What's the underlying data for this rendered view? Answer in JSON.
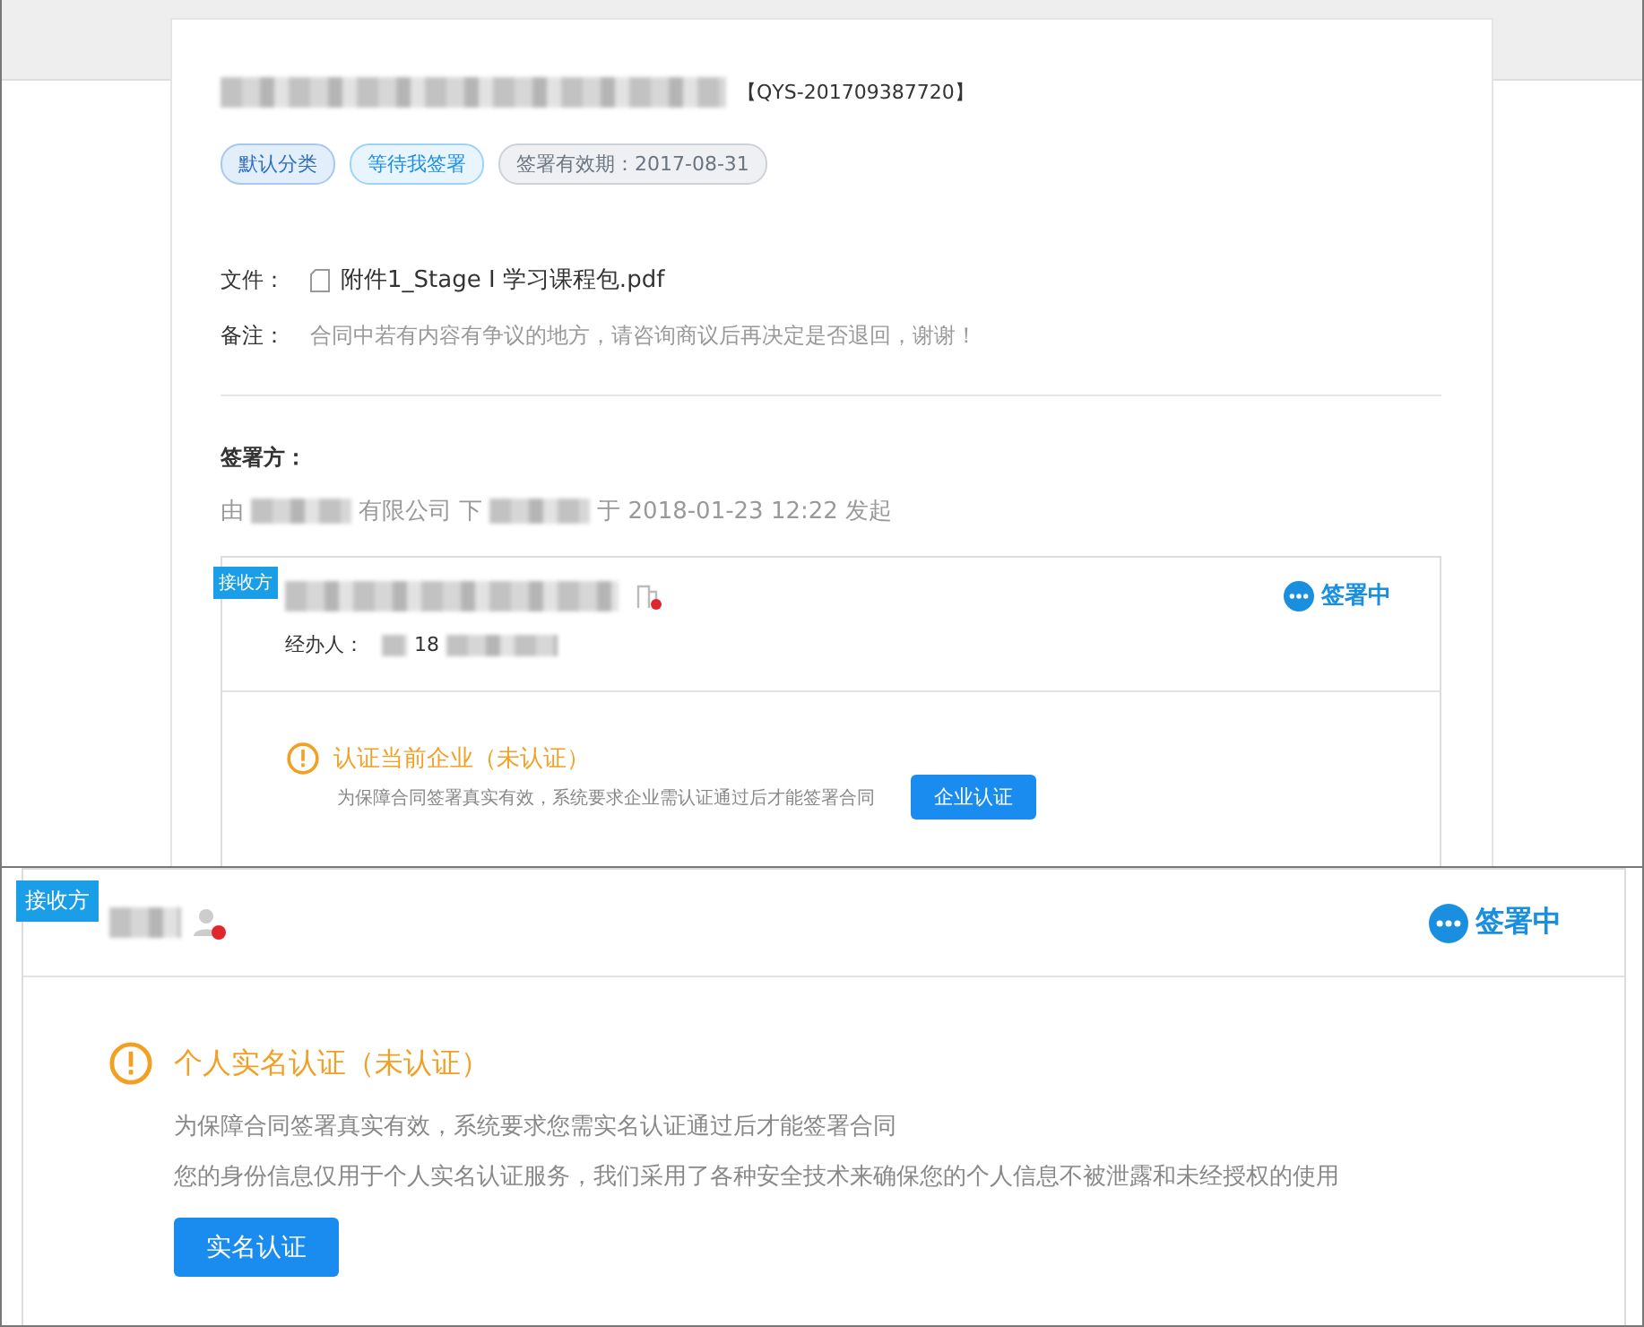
{
  "contract": {
    "code": "【QYS-201709387720】",
    "tags": [
      {
        "label": "默认分类",
        "kind": "category"
      },
      {
        "label": "等待我签署",
        "kind": "status"
      },
      {
        "label": "签署有效期：2017-08-31",
        "kind": "deadline"
      }
    ],
    "file": {
      "label": "文件：",
      "name": "附件1_Stage I 学习课程包.pdf"
    },
    "remark": {
      "label": "备注：",
      "text": "合同中若有内容有争议的地方，请咨询商议后再决定是否退回，谢谢！"
    }
  },
  "signers": {
    "heading": "签署方：",
    "initiator": [
      {
        "kind": "text",
        "text": "由"
      },
      {
        "kind": "redacted"
      },
      {
        "kind": "text",
        "text": "有限公司 下"
      },
      {
        "kind": "redacted"
      },
      {
        "kind": "text",
        "text": "于 2018-01-23 12:22 发起"
      }
    ],
    "company": {
      "role": "接收方",
      "status": "签署中",
      "handler_label": "经办人：",
      "handler_phone_prefix": "18",
      "verify_title": "认证当前企业（未认证）",
      "verify_desc": "为保障合同签署真实有效，系统要求企业需认证通过后才能签署合同",
      "verify_button": "企业认证"
    }
  },
  "overlay": {
    "role": "接收方",
    "status": "签署中",
    "verify_title": "个人实名认证（未认证）",
    "verify_lines": [
      "为保障合同签署真实有效，系统要求您需实名认证通过后才能签署合同",
      "您的身份信息仅用于个人实名认证服务，我们采用了各种安全技术来确保您的个人信息不被泄露和未经授权的使用"
    ],
    "verify_button": "实名认证"
  }
}
